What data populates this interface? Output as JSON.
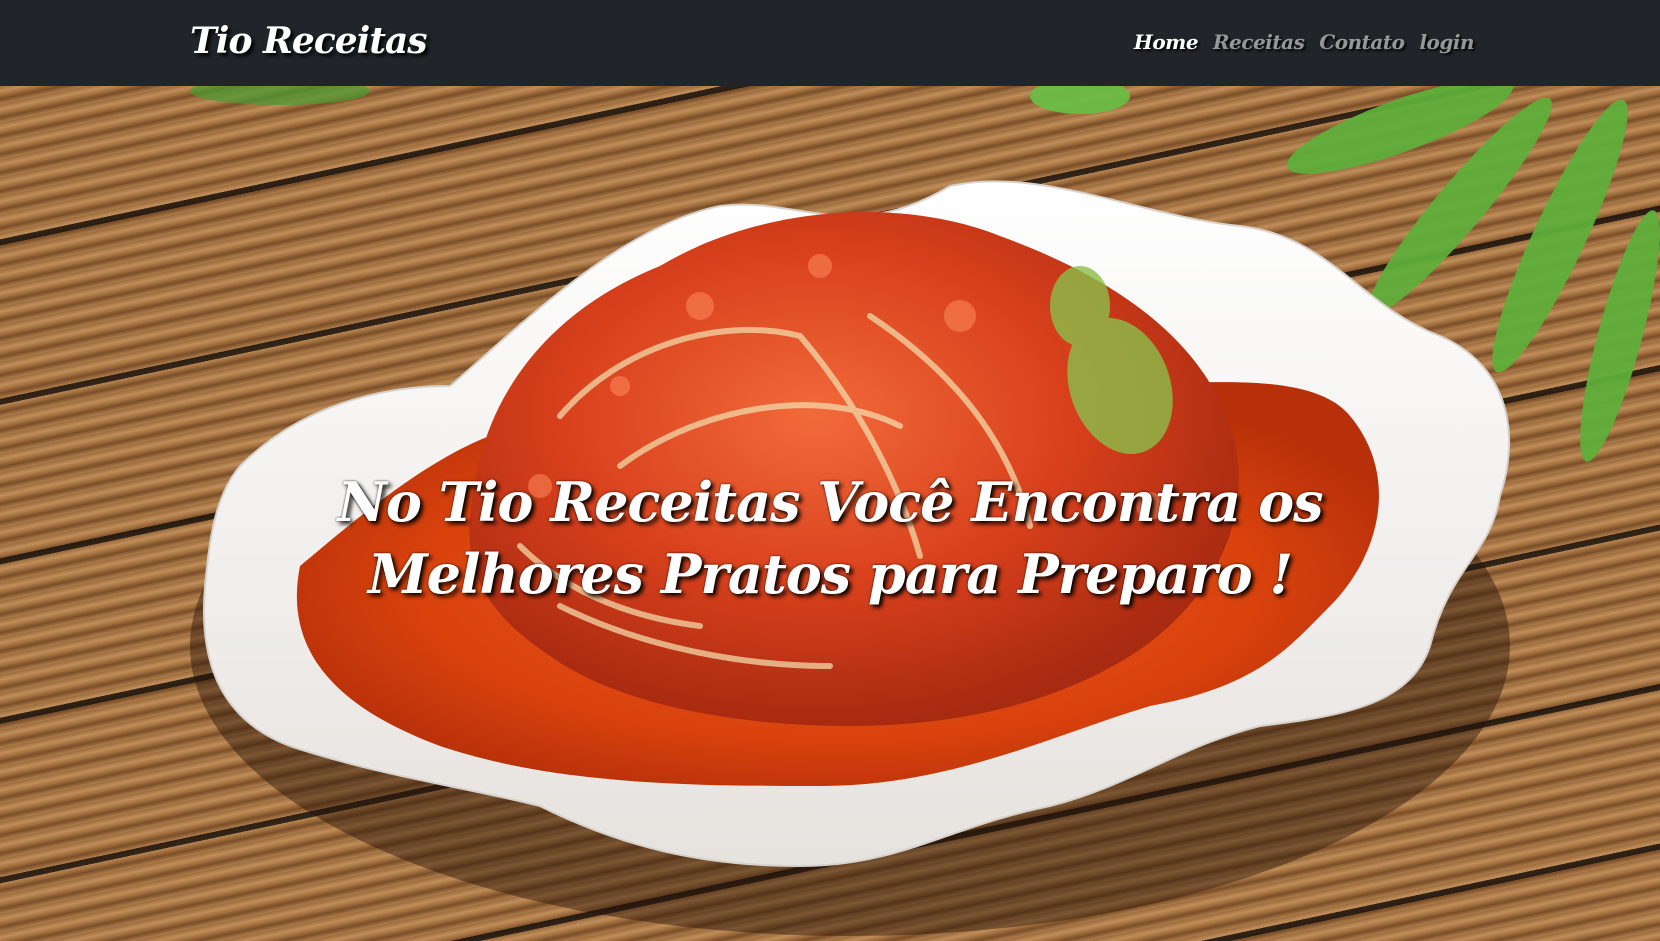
{
  "navbar": {
    "brand": "Tio Receitas",
    "links": [
      {
        "label": "Home",
        "active": true
      },
      {
        "label": "Receitas",
        "active": false
      },
      {
        "label": "Contato",
        "active": false
      },
      {
        "label": "login",
        "active": false
      }
    ]
  },
  "hero": {
    "headline": "No Tio Receitas Você Encontra os Melhores Pratos para Preparo !"
  },
  "colors": {
    "navbar_bg": "#212529",
    "link_active": "#ffffff",
    "link_inactive": "rgba(255,255,255,0.55)"
  }
}
